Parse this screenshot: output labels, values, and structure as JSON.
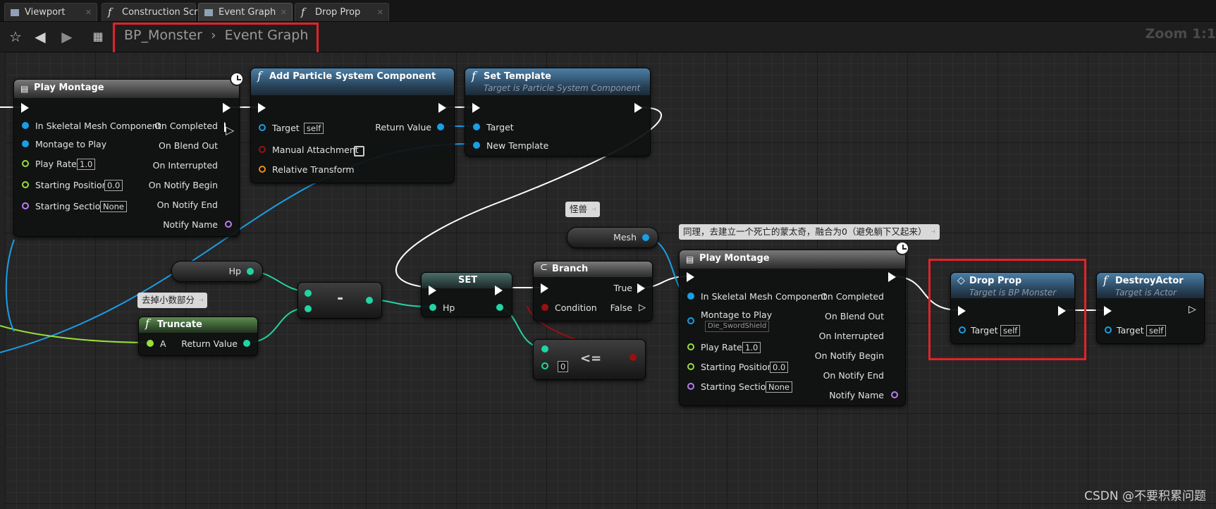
{
  "tabs": [
    {
      "label": "Viewport",
      "icon": "grid-icon"
    },
    {
      "label": "Construction Scrip",
      "icon": "function-icon"
    },
    {
      "label": "Event Graph",
      "icon": "grid-icon"
    },
    {
      "label": "Drop Prop",
      "icon": "function-icon"
    }
  ],
  "toolbar": {
    "breadcrumb_root": "BP_Monster",
    "breadcrumb_sep": "›",
    "breadcrumb_current": "Event Graph",
    "zoom": "Zoom 1:1"
  },
  "colors": {
    "exec": "#ffffff",
    "object_pin": "#1a9ee6",
    "float_pin": "#98df3a",
    "int_pin": "#22d4a4",
    "bool_pin": "#9a1010",
    "transform_pin": "#f08a1c",
    "name_pin": "#b77ef0",
    "highlight": "#e0232a"
  },
  "nodes": {
    "play_montage_1": {
      "title": "Play Montage",
      "inputs": [
        "In Skeletal Mesh Component",
        "Montage to Play",
        "Play Rate",
        "Starting Position",
        "Starting Section"
      ],
      "outputs": [
        "On Completed",
        "On Blend Out",
        "On Interrupted",
        "On Notify Begin",
        "On Notify End",
        "Notify Name"
      ],
      "play_rate": "1.0",
      "starting_position": "0.0",
      "starting_section": "None"
    },
    "add_particle": {
      "title": "Add Particle System Component",
      "target_label": "Target",
      "target_value": "self",
      "manual_attachment": "Manual Attachment",
      "relative_transform": "Relative Transform",
      "return_value": "Return Value"
    },
    "set_template": {
      "title": "Set Template",
      "subtitle": "Target is Particle System Component",
      "target": "Target",
      "new_template": "New Template"
    },
    "hp_getter": {
      "label": "Hp"
    },
    "mesh_getter": {
      "label": "Mesh"
    },
    "truncate": {
      "title": "Truncate",
      "input": "A",
      "output": "Return Value"
    },
    "subtract": {
      "symbol": "-"
    },
    "set_hp": {
      "title": "SET",
      "pin": "Hp"
    },
    "branch": {
      "title": "Branch",
      "condition": "Condition",
      "true_label": "True",
      "false_label": "False"
    },
    "less_equal": {
      "symbol": "<=",
      "value": "0"
    },
    "play_montage_2": {
      "title": "Play Montage",
      "inputs": [
        "In Skeletal Mesh Component",
        "Montage to Play",
        "Play Rate",
        "Starting Position",
        "Starting Section"
      ],
      "outputs": [
        "On Completed",
        "On Blend Out",
        "On Interrupted",
        "On Notify Begin",
        "On Notify End",
        "Notify Name"
      ],
      "montage": "Die_SwordShield",
      "play_rate": "1.0",
      "starting_position": "0.0",
      "starting_section": "None"
    },
    "drop_prop": {
      "title": "Drop Prop",
      "subtitle": "Target is BP Monster",
      "target": "Target",
      "target_value": "self"
    },
    "destroy_actor": {
      "title": "DestroyActor",
      "subtitle": "Target is Actor",
      "target": "Target",
      "target_value": "self"
    }
  },
  "comments": {
    "monster": "怪兽",
    "truncate_note": "去掉小数部分",
    "montage_note": "同理，去建立一个死亡的蒙太奇，融合为0（避免躺下又起来）"
  },
  "watermark": "CSDN @不要积累问题"
}
